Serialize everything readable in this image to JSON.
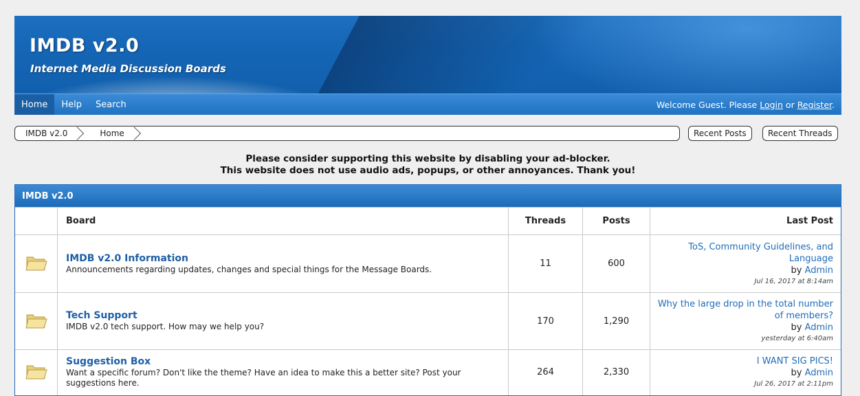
{
  "header": {
    "title": "IMDB v2.0",
    "subtitle": "Internet Media Discussion Boards"
  },
  "nav": {
    "items": [
      {
        "label": "Home",
        "active": true
      },
      {
        "label": "Help",
        "active": false
      },
      {
        "label": "Search",
        "active": false
      }
    ],
    "welcome_prefix": "Welcome Guest. Please ",
    "login": "Login",
    "or": " or ",
    "register": "Register",
    "suffix": "."
  },
  "breadcrumb": {
    "items": [
      "IMDB v2.0",
      "Home"
    ],
    "recent_posts": "Recent Posts",
    "recent_threads": "Recent Threads"
  },
  "notice": {
    "line1": "Please consider supporting this website by disabling your ad-blocker.",
    "line2": "This website does not use audio ads, popups, or other annoyances. Thank you!"
  },
  "forum": {
    "title": "IMDB v2.0",
    "columns": {
      "board": "Board",
      "threads": "Threads",
      "posts": "Posts",
      "last_post": "Last Post"
    },
    "boards": [
      {
        "name": "IMDB v2.0 Information",
        "description": "Announcements regarding updates, changes and special things for the Message Boards.",
        "threads": "11",
        "posts": "600",
        "last_post_title": "ToS, Community Guidelines, and Language",
        "by": "by ",
        "author": "Admin",
        "date": "Jul 16, 2017 at 8:14am"
      },
      {
        "name": "Tech Support",
        "description": "IMDB v2.0 tech support. How may we help you?",
        "threads": "170",
        "posts": "1,290",
        "last_post_title": "Why the large drop in the total number of members?",
        "by": "by ",
        "author": "Admin",
        "date": "yesterday at 6:40am"
      },
      {
        "name": "Suggestion Box",
        "description": "Want a specific forum? Don't like the theme? Have an idea to make this a better site? Post your suggestions here.",
        "threads": "264",
        "posts": "2,330",
        "last_post_title": "I WANT SIG PICS!",
        "by": "by ",
        "author": "Admin",
        "date": "Jul 26, 2017 at 2:11pm"
      }
    ]
  },
  "colors": {
    "brand_blue": "#1f6cb8",
    "link_blue": "#1f5fa6",
    "folder_yellow": "#f2dc8c"
  },
  "icons": {
    "board_icon": "folder-icon",
    "breadcrumb_separator": "chevron-right-icon"
  }
}
